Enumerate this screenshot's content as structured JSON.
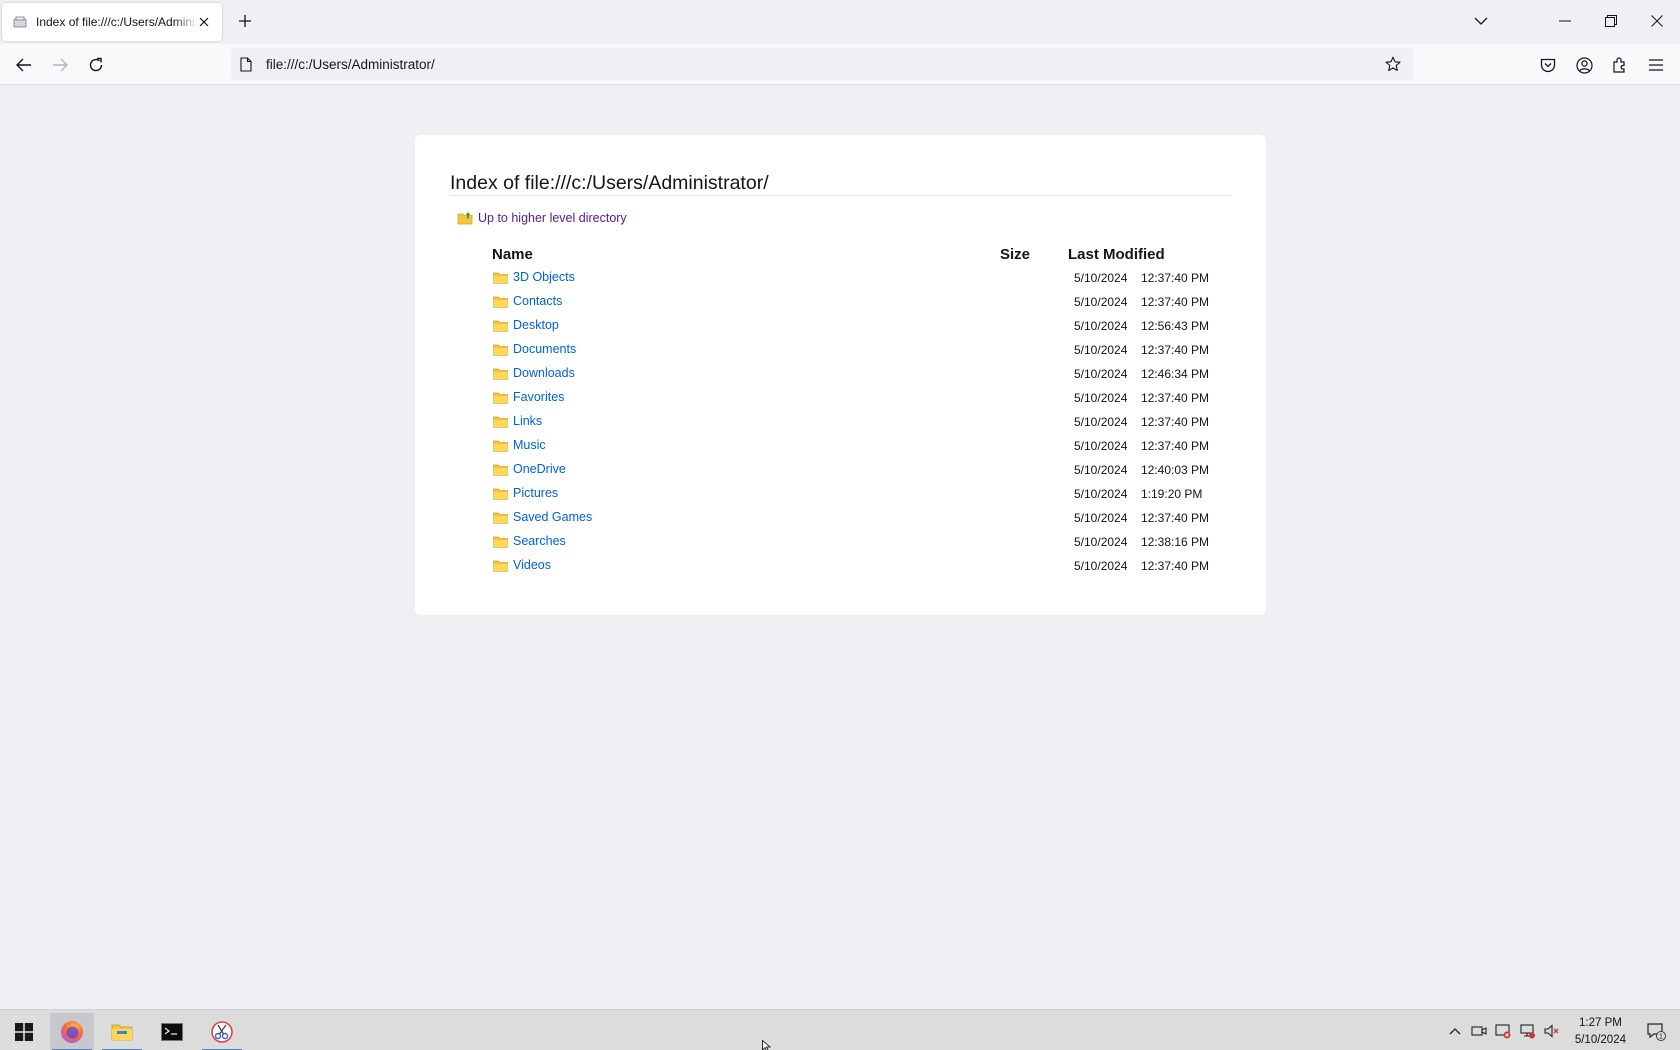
{
  "browser": {
    "tab_title": "Index of file:///c:/Users/Administrator/",
    "url": "file:///c:/Users/Administrator/"
  },
  "page": {
    "heading": "Index of file:///c:/Users/Administrator/",
    "up_link": "Up to higher level directory",
    "columns": {
      "name": "Name",
      "size": "Size",
      "modified": "Last Modified"
    },
    "entries": [
      {
        "name": "3D Objects",
        "size": "",
        "date": "5/10/2024",
        "time": "12:37:40 PM"
      },
      {
        "name": "Contacts",
        "size": "",
        "date": "5/10/2024",
        "time": "12:37:40 PM"
      },
      {
        "name": "Desktop",
        "size": "",
        "date": "5/10/2024",
        "time": "12:56:43 PM"
      },
      {
        "name": "Documents",
        "size": "",
        "date": "5/10/2024",
        "time": "12:37:40 PM"
      },
      {
        "name": "Downloads",
        "size": "",
        "date": "5/10/2024",
        "time": "12:46:34 PM"
      },
      {
        "name": "Favorites",
        "size": "",
        "date": "5/10/2024",
        "time": "12:37:40 PM"
      },
      {
        "name": "Links",
        "size": "",
        "date": "5/10/2024",
        "time": "12:37:40 PM"
      },
      {
        "name": "Music",
        "size": "",
        "date": "5/10/2024",
        "time": "12:37:40 PM"
      },
      {
        "name": "OneDrive",
        "size": "",
        "date": "5/10/2024",
        "time": "12:40:03 PM"
      },
      {
        "name": "Pictures",
        "size": "",
        "date": "5/10/2024",
        "time": "1:19:20 PM"
      },
      {
        "name": "Saved Games",
        "size": "",
        "date": "5/10/2024",
        "time": "12:37:40 PM"
      },
      {
        "name": "Searches",
        "size": "",
        "date": "5/10/2024",
        "time": "12:38:16 PM"
      },
      {
        "name": "Videos",
        "size": "",
        "date": "5/10/2024",
        "time": "12:37:40 PM"
      }
    ]
  },
  "taskbar": {
    "apps": [
      "start-icon",
      "firefox-icon",
      "file-explorer-icon",
      "terminal-icon",
      "snipping-tool-icon"
    ],
    "clock_time": "1:27 PM",
    "clock_date": "5/10/2024",
    "notification_count": "1"
  },
  "colors": {
    "link": "#0060df",
    "visited_link": "#551a8b",
    "folder": "#f5c342",
    "chrome_bg": "#f0f0f4",
    "taskbar_accent": "#4a86d6"
  }
}
